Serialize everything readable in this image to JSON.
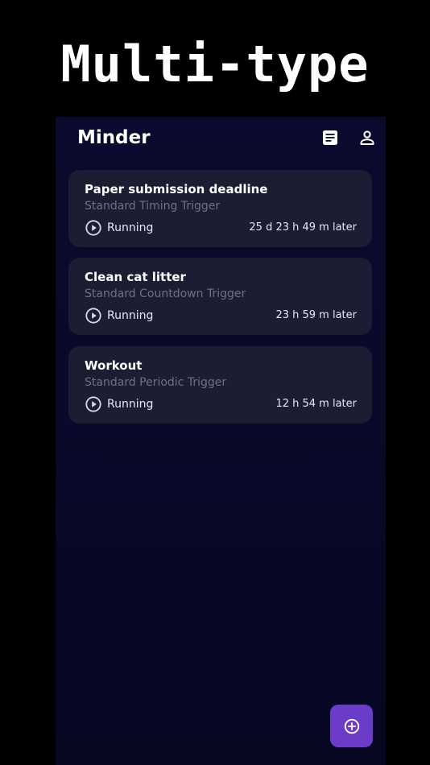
{
  "promo": {
    "title": "Multi-type"
  },
  "app_bar": {
    "title": "Minder",
    "icons": [
      "notes-icon",
      "account-icon"
    ]
  },
  "triggers": [
    {
      "title": "Paper submission deadline",
      "type": "Standard Timing Trigger",
      "status": "Running",
      "remaining": "25 d 23 h 49 m later"
    },
    {
      "title": "Clean cat litter",
      "type": "Standard Countdown Trigger",
      "status": "Running",
      "remaining": "23 h 59 m later"
    },
    {
      "title": "Workout",
      "type": "Standard Periodic Trigger",
      "status": "Running",
      "remaining": "12 h 54 m later"
    }
  ],
  "fab": {
    "icon": "add-circle-icon"
  },
  "colors": {
    "background": "#000000",
    "surface": "#0a0a2e",
    "card": "#1c1c33",
    "accent": "#6a3cc8",
    "muted_text": "#6f6f86"
  }
}
